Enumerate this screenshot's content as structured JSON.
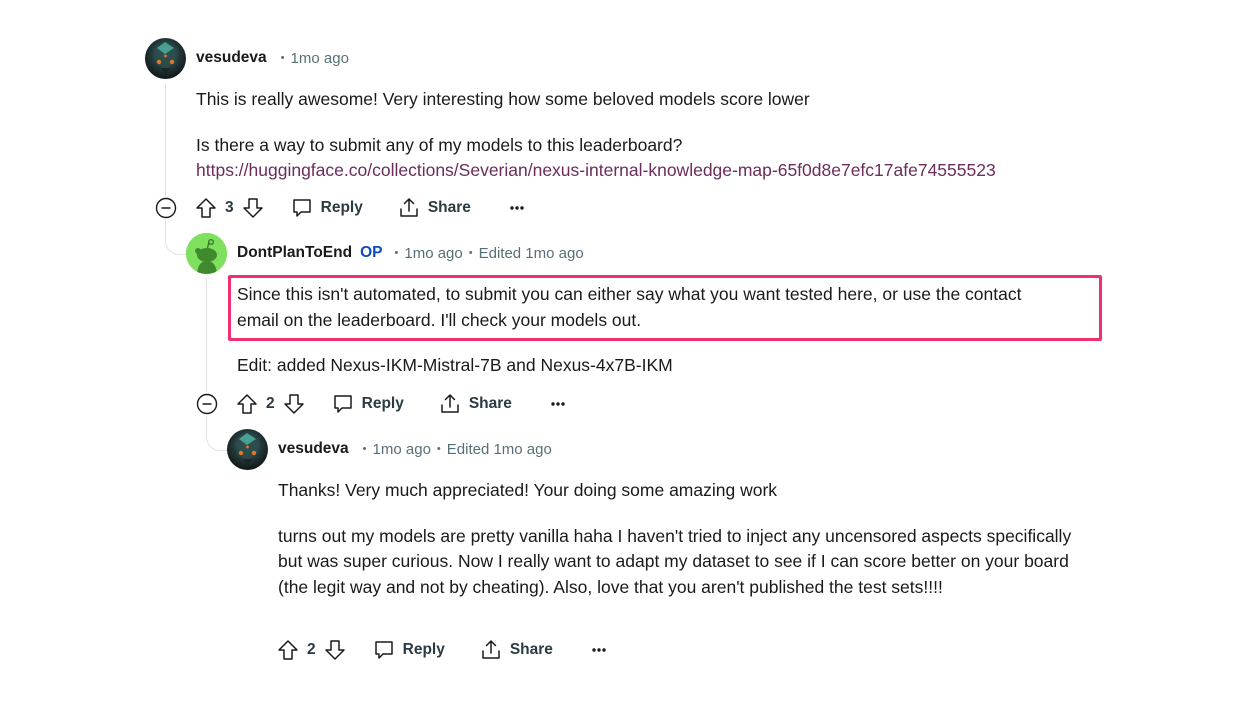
{
  "comments": [
    {
      "author": "vesudeva",
      "op_badge": "",
      "time": "1mo ago",
      "edited": "",
      "paragraphs": [
        "This is really awesome! Very interesting how some beloved models score lower",
        "Is there a way to submit any of my models to this leaderboard?"
      ],
      "link": "https://huggingface.co/collections/Severian/nexus-internal-knowledge-map-65f0d8e7efc17afe74555523",
      "score": "3",
      "reply_label": "Reply",
      "share_label": "Share",
      "avatar_icon": "dragon-avatar-icon"
    },
    {
      "author": "DontPlanToEnd",
      "op_badge": "OP",
      "time": "1mo ago",
      "edited": "Edited 1mo ago",
      "highlighted_line1": "Since this isn't automated, to submit you can either say what you want tested here, or use the contact",
      "highlighted_line2": "email on the leaderboard. I'll check your models out.",
      "paragraphs": [
        "Edit: added Nexus-IKM-Mistral-7B and Nexus-4x7B-IKM"
      ],
      "score": "2",
      "reply_label": "Reply",
      "share_label": "Share",
      "avatar_icon": "snoo-avatar-icon"
    },
    {
      "author": "vesudeva",
      "op_badge": "",
      "time": "1mo ago",
      "edited": "Edited 1mo ago",
      "paragraphs": [
        "Thanks! Very much appreciated! Your doing some amazing work",
        "turns out my models are pretty vanilla haha I haven't tried to inject any uncensored aspects specifically but was super curious. Now I really want to adapt my dataset to see if I can score better on your board (the legit way and not by cheating). Also, love that you aren't published the test sets!!!!"
      ],
      "score": "2",
      "reply_label": "Reply",
      "share_label": "Share",
      "avatar_icon": "dragon-avatar-icon"
    }
  ],
  "colors": {
    "highlight_border": "#f0306e",
    "op_badge": "#0a4bbd",
    "link": "#6b2d5c",
    "meta_text": "#576f76",
    "snoo_bg": "#7ee05c"
  }
}
